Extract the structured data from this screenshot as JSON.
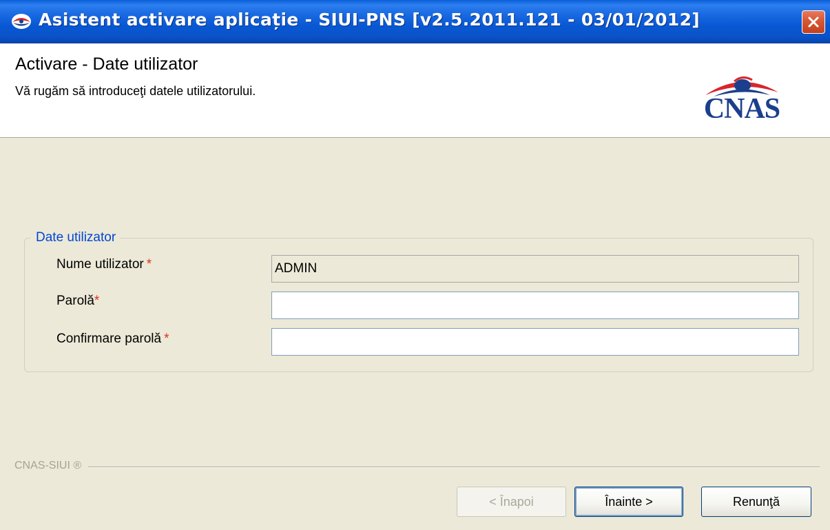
{
  "window": {
    "title": "Asistent activare aplicație - SIUI-PNS [v2.5.2011.121 - 03/01/2012]",
    "app_icon": "cnas-eye-icon",
    "close_icon": "close-icon"
  },
  "header": {
    "title": "Activare - Date utilizator",
    "subtitle": "Vă rugăm să introduceţi datele utilizatorului.",
    "logo_text": "CNAS"
  },
  "user_group": {
    "legend": "Date utilizator",
    "required_marker": "*",
    "fields": [
      {
        "label": "Nume utilizator",
        "value": "ADMIN",
        "readonly": true
      },
      {
        "label": "Parolă",
        "value": "",
        "readonly": false
      },
      {
        "label": "Confirmare parolă",
        "value": "",
        "readonly": false
      }
    ]
  },
  "footer": {
    "brand": "CNAS-SIUI ®",
    "buttons": {
      "back": "< Înapoi",
      "next": "Înainte >",
      "cancel": "Renunţă"
    },
    "back_enabled": false
  },
  "colors": {
    "titlebar": "#0858d4",
    "legend": "#0046d5",
    "required": "#e0301e",
    "logo": "#1b3f8c"
  }
}
